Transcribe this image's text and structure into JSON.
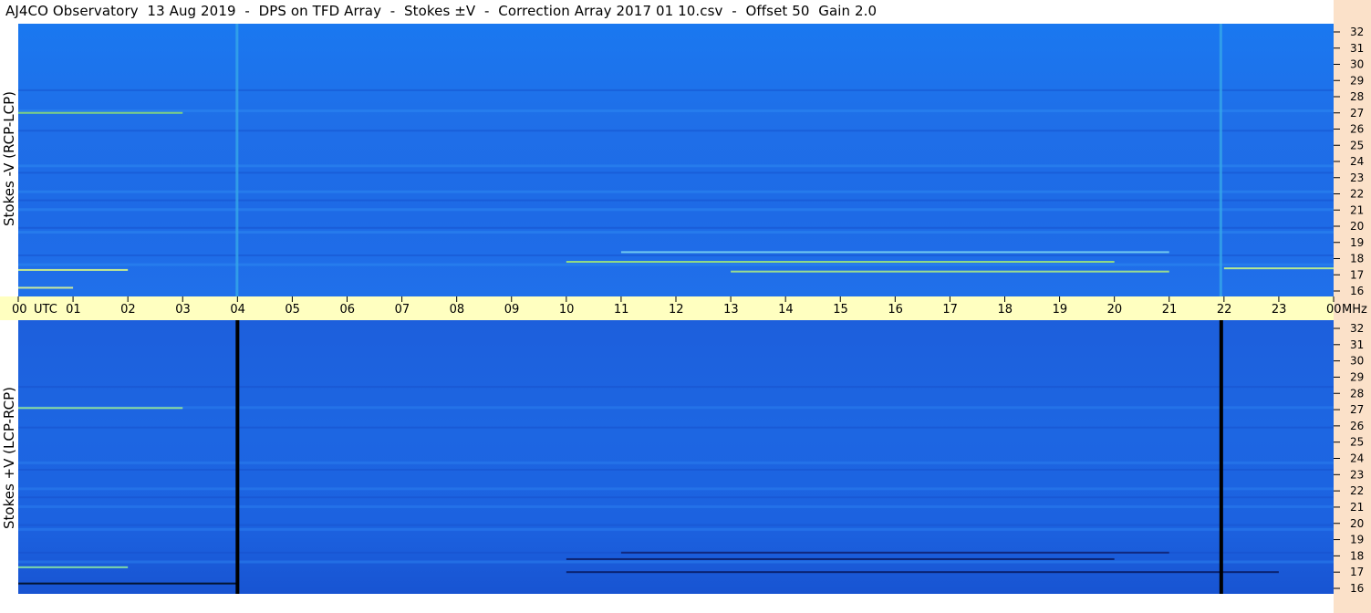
{
  "header": {
    "title": "AJ4CO Observatory  13 Aug 2019  -  DPS on TFD Array  -  Stokes ±V  -  Correction Array 2017 01 10.csv  -  Offset 50  Gain 2.0"
  },
  "chart_data": [
    {
      "type": "heatmap",
      "title": "AJ4CO Observatory  13 Aug 2019  -  DPS on TFD Array  -  Stokes ±V  -  Correction Array 2017 01 10.csv  -  Offset 50  Gain 2.0",
      "ylabel": "Stokes -V (RCP-LCP)",
      "xlabel": "UTC",
      "x_ticks": [
        "00",
        "01",
        "02",
        "03",
        "04",
        "05",
        "06",
        "07",
        "08",
        "09",
        "10",
        "11",
        "12",
        "13",
        "14",
        "15",
        "16",
        "17",
        "18",
        "19",
        "20",
        "21",
        "22",
        "23",
        "00"
      ],
      "y_ticks": [
        "16",
        "17",
        "18",
        "19",
        "20",
        "21",
        "22",
        "23",
        "24",
        "25",
        "26",
        "27",
        "28",
        "29",
        "30",
        "31",
        "32"
      ],
      "y_unit": "MHz",
      "ylim": [
        16,
        32
      ],
      "xlim": [
        0,
        24
      ]
    },
    {
      "type": "heatmap",
      "ylabel": "Stokes +V (LCP-RCP)",
      "xlabel": "UTC",
      "x_ticks": [
        "00",
        "01",
        "02",
        "03",
        "04",
        "05",
        "06",
        "07",
        "08",
        "09",
        "10",
        "11",
        "12",
        "13",
        "14",
        "15",
        "16",
        "17",
        "18",
        "19",
        "20",
        "21",
        "22",
        "23",
        "00"
      ],
      "y_ticks": [
        "16",
        "17",
        "18",
        "19",
        "20",
        "21",
        "22",
        "23",
        "24",
        "25",
        "26",
        "27",
        "28",
        "29",
        "30",
        "31",
        "32"
      ],
      "y_unit": "MHz",
      "ylim": [
        16,
        32
      ],
      "xlim": [
        0,
        24
      ]
    }
  ],
  "axis": {
    "utc_label": "UTC",
    "unit_label": "MHz"
  },
  "colors": {
    "background_blue": "#1f6fe8",
    "time_strip": "#ffffc0",
    "freq_strip": "#fbe1c9"
  }
}
